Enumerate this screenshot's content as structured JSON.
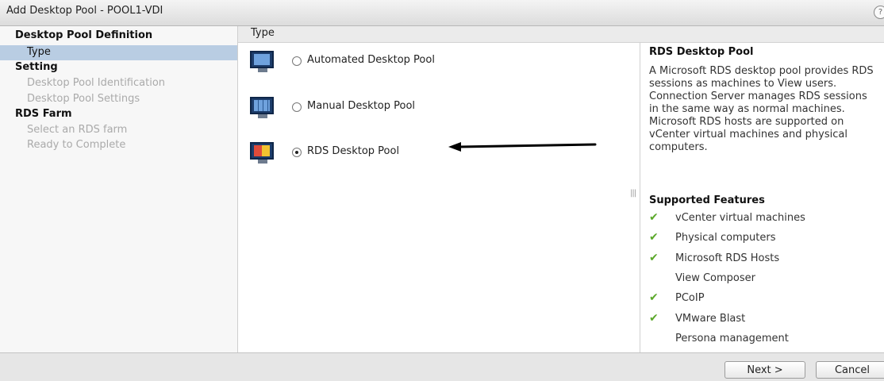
{
  "window": {
    "title": "Add Desktop Pool - POOL1-VDI"
  },
  "sidebar": {
    "sections": [
      {
        "heading": "Desktop Pool Definition",
        "steps": [
          "Type"
        ]
      },
      {
        "heading": "Setting",
        "steps": [
          "Desktop Pool Identification",
          "Desktop Pool Settings"
        ]
      },
      {
        "heading": "RDS Farm",
        "steps": [
          "Select an RDS farm",
          "Ready to Complete"
        ]
      }
    ],
    "active_step": "Type"
  },
  "main": {
    "section_title": "Type",
    "options": [
      {
        "label": "Automated Desktop Pool",
        "selected": false,
        "icon": "automated-pool-icon"
      },
      {
        "label": "Manual Desktop Pool",
        "selected": false,
        "icon": "manual-pool-icon"
      },
      {
        "label": "RDS Desktop Pool",
        "selected": true,
        "icon": "rds-pool-icon"
      }
    ]
  },
  "details": {
    "title": "RDS Desktop Pool",
    "description": "A Microsoft RDS desktop pool provides RDS sessions as machines to View users. Connection Server manages RDS sessions in the same way as normal machines. Microsoft RDS hosts are supported on vCenter virtual machines and physical computers.",
    "features_title": "Supported Features",
    "features": [
      {
        "label": "vCenter virtual machines",
        "supported": true
      },
      {
        "label": "Physical computers",
        "supported": true
      },
      {
        "label": "Microsoft RDS Hosts",
        "supported": true
      },
      {
        "label": "View Composer",
        "supported": false
      },
      {
        "label": "PCoIP",
        "supported": true
      },
      {
        "label": "VMware Blast",
        "supported": true
      },
      {
        "label": "Persona management",
        "supported": false
      }
    ]
  },
  "footer": {
    "next_label": "Next >",
    "cancel_label": "Cancel"
  },
  "colors": {
    "check": "#5ba82a",
    "selection": "#b9cde3",
    "monitor": "#1d3d6b"
  }
}
